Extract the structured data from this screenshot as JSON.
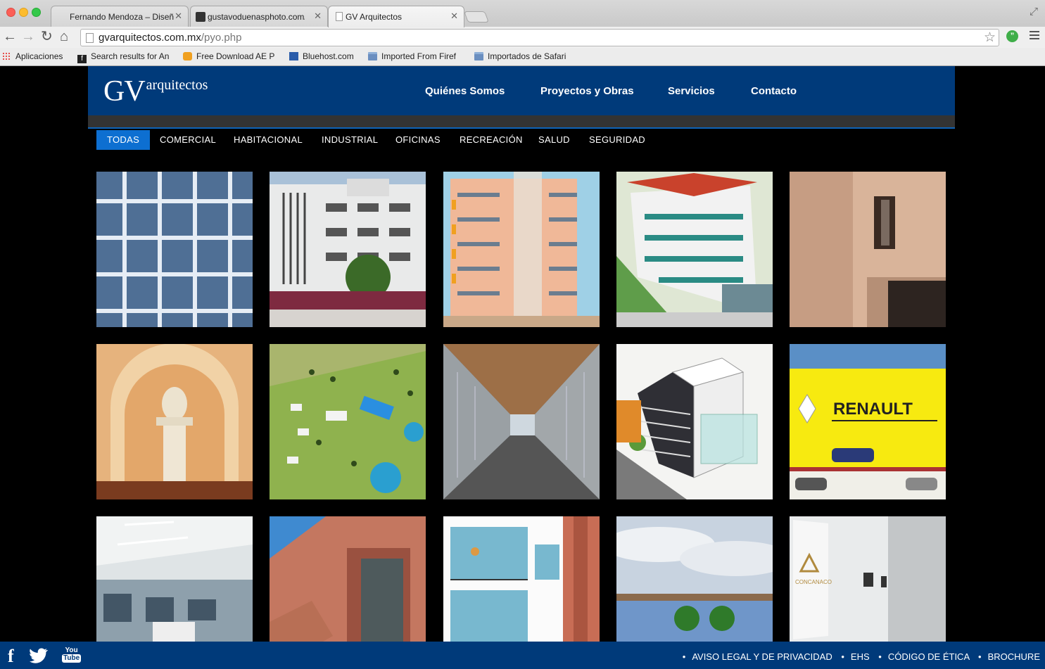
{
  "browser": {
    "tabs": [
      {
        "title": "Fernando Mendoza – Diseñ",
        "active": false
      },
      {
        "title": "gustavoduenasphoto.com/",
        "active": false
      },
      {
        "title": "GV Arquitectos",
        "active": true
      }
    ],
    "url_domain": "gvarquitectos.com.mx",
    "url_path": "/pyo.php",
    "bookmarks": [
      {
        "label": "Aplicaciones"
      },
      {
        "label": "Search results for An"
      },
      {
        "label": "Free Download AE P"
      },
      {
        "label": "Bluehost.com"
      },
      {
        "label": "Imported From Firef"
      },
      {
        "label": "Importados de Safari"
      }
    ]
  },
  "site": {
    "logo_main": "GV",
    "logo_sub": "arquitectos",
    "nav": [
      "Quiénes Somos",
      "Proyectos y Obras",
      "Servicios",
      "Contacto"
    ],
    "filters": [
      "TODAS",
      "COMERCIAL",
      "HABITACIONAL",
      "INDUSTRIAL",
      "OFICINAS",
      "RECREACIÓN",
      "SALUD",
      "SEGURIDAD"
    ],
    "active_filter": "TODAS",
    "footer_links": [
      "AVISO LEGAL Y DE PRIVACIDAD",
      "EHS",
      "CÓDIGO DE ÉTICA",
      "BROCHURE"
    ],
    "social": [
      "facebook-icon",
      "twitter-icon",
      "youtube-icon"
    ],
    "thumb_sign": "RENAULT",
    "thumb_sign2": "CONCANACO"
  },
  "colors": {
    "header_blue": "#003a7a",
    "filter_active": "#0d6fd1",
    "page_bg": "#000000"
  }
}
